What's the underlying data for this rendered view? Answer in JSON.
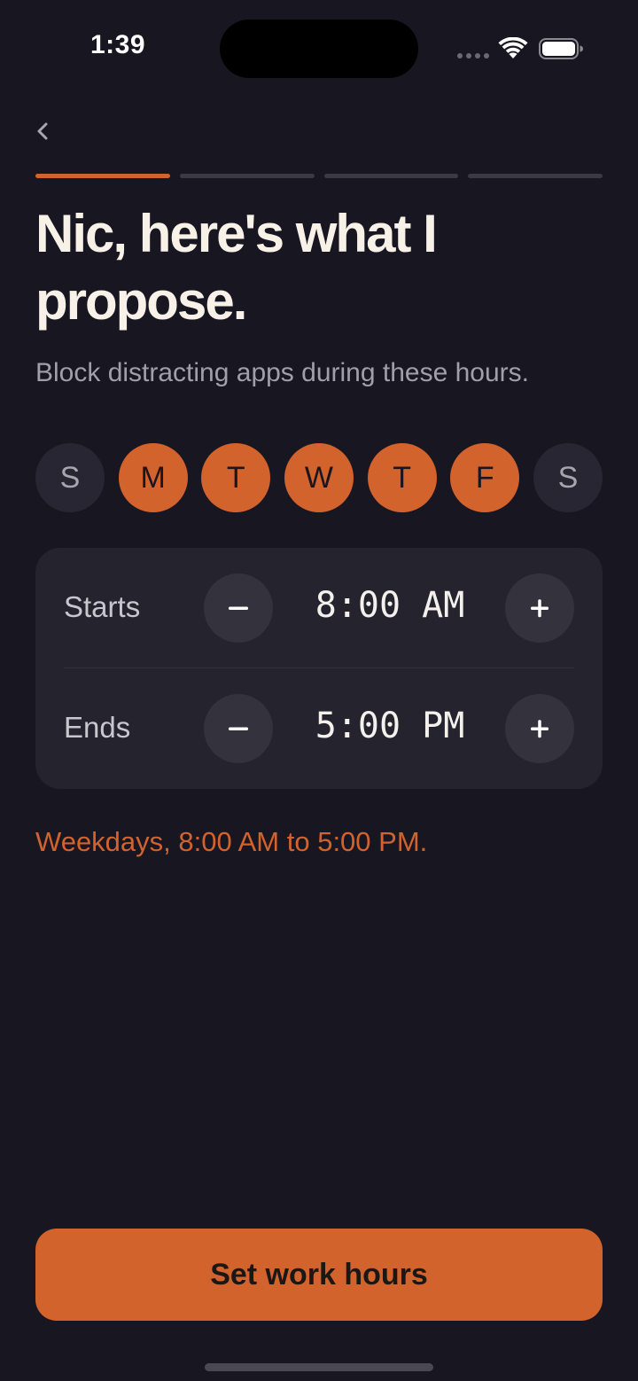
{
  "status_bar": {
    "time": "1:39"
  },
  "navigation": {
    "back_icon": "chevron-left-icon",
    "progress_steps_total": 4,
    "progress_step_current": 1
  },
  "header": {
    "title": "Nic, here's what I propose.",
    "subtitle": "Block distracting apps during these hours."
  },
  "days": [
    {
      "label": "S",
      "selected": false
    },
    {
      "label": "M",
      "selected": true
    },
    {
      "label": "T",
      "selected": true
    },
    {
      "label": "W",
      "selected": true
    },
    {
      "label": "T",
      "selected": true
    },
    {
      "label": "F",
      "selected": true
    },
    {
      "label": "S",
      "selected": false
    }
  ],
  "schedule": {
    "start": {
      "label": "Starts",
      "value": "8:00 AM"
    },
    "end": {
      "label": "Ends",
      "value": "5:00 PM"
    }
  },
  "summary": "Weekdays, 8:00 AM to 5:00 PM.",
  "cta": {
    "label": "Set work hours"
  },
  "colors": {
    "background": "#181621",
    "accent": "#d2632d",
    "card": "#24232e",
    "title": "#f7f1e8"
  }
}
